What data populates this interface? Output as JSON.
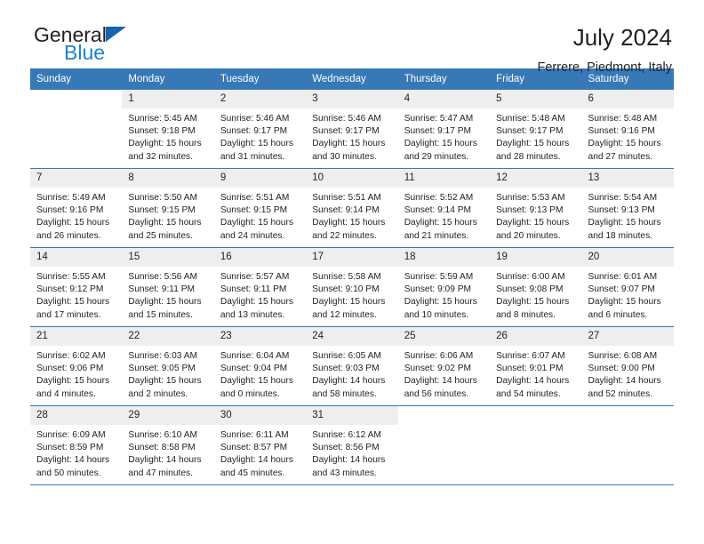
{
  "brand": {
    "name_part1": "General",
    "name_part2": "Blue",
    "logo_icon": "triangle-flag-icon"
  },
  "header": {
    "title": "July 2024",
    "location": "Ferrere, Piedmont, Italy"
  },
  "colors": {
    "header_blue": "#3778b7",
    "brand_blue": "#1b84c8",
    "logo_blue": "#1664ad",
    "daynum_bg": "#eeeeee",
    "text": "#231f20"
  },
  "calendar": {
    "weekday_headers": [
      "Sunday",
      "Monday",
      "Tuesday",
      "Wednesday",
      "Thursday",
      "Friday",
      "Saturday"
    ],
    "weeks": [
      [
        {
          "day": "",
          "lines": []
        },
        {
          "day": "1",
          "lines": [
            "Sunrise: 5:45 AM",
            "Sunset: 9:18 PM",
            "Daylight: 15 hours",
            "and 32 minutes."
          ]
        },
        {
          "day": "2",
          "lines": [
            "Sunrise: 5:46 AM",
            "Sunset: 9:17 PM",
            "Daylight: 15 hours",
            "and 31 minutes."
          ]
        },
        {
          "day": "3",
          "lines": [
            "Sunrise: 5:46 AM",
            "Sunset: 9:17 PM",
            "Daylight: 15 hours",
            "and 30 minutes."
          ]
        },
        {
          "day": "4",
          "lines": [
            "Sunrise: 5:47 AM",
            "Sunset: 9:17 PM",
            "Daylight: 15 hours",
            "and 29 minutes."
          ]
        },
        {
          "day": "5",
          "lines": [
            "Sunrise: 5:48 AM",
            "Sunset: 9:17 PM",
            "Daylight: 15 hours",
            "and 28 minutes."
          ]
        },
        {
          "day": "6",
          "lines": [
            "Sunrise: 5:48 AM",
            "Sunset: 9:16 PM",
            "Daylight: 15 hours",
            "and 27 minutes."
          ]
        }
      ],
      [
        {
          "day": "7",
          "lines": [
            "Sunrise: 5:49 AM",
            "Sunset: 9:16 PM",
            "Daylight: 15 hours",
            "and 26 minutes."
          ]
        },
        {
          "day": "8",
          "lines": [
            "Sunrise: 5:50 AM",
            "Sunset: 9:15 PM",
            "Daylight: 15 hours",
            "and 25 minutes."
          ]
        },
        {
          "day": "9",
          "lines": [
            "Sunrise: 5:51 AM",
            "Sunset: 9:15 PM",
            "Daylight: 15 hours",
            "and 24 minutes."
          ]
        },
        {
          "day": "10",
          "lines": [
            "Sunrise: 5:51 AM",
            "Sunset: 9:14 PM",
            "Daylight: 15 hours",
            "and 22 minutes."
          ]
        },
        {
          "day": "11",
          "lines": [
            "Sunrise: 5:52 AM",
            "Sunset: 9:14 PM",
            "Daylight: 15 hours",
            "and 21 minutes."
          ]
        },
        {
          "day": "12",
          "lines": [
            "Sunrise: 5:53 AM",
            "Sunset: 9:13 PM",
            "Daylight: 15 hours",
            "and 20 minutes."
          ]
        },
        {
          "day": "13",
          "lines": [
            "Sunrise: 5:54 AM",
            "Sunset: 9:13 PM",
            "Daylight: 15 hours",
            "and 18 minutes."
          ]
        }
      ],
      [
        {
          "day": "14",
          "lines": [
            "Sunrise: 5:55 AM",
            "Sunset: 9:12 PM",
            "Daylight: 15 hours",
            "and 17 minutes."
          ]
        },
        {
          "day": "15",
          "lines": [
            "Sunrise: 5:56 AM",
            "Sunset: 9:11 PM",
            "Daylight: 15 hours",
            "and 15 minutes."
          ]
        },
        {
          "day": "16",
          "lines": [
            "Sunrise: 5:57 AM",
            "Sunset: 9:11 PM",
            "Daylight: 15 hours",
            "and 13 minutes."
          ]
        },
        {
          "day": "17",
          "lines": [
            "Sunrise: 5:58 AM",
            "Sunset: 9:10 PM",
            "Daylight: 15 hours",
            "and 12 minutes."
          ]
        },
        {
          "day": "18",
          "lines": [
            "Sunrise: 5:59 AM",
            "Sunset: 9:09 PM",
            "Daylight: 15 hours",
            "and 10 minutes."
          ]
        },
        {
          "day": "19",
          "lines": [
            "Sunrise: 6:00 AM",
            "Sunset: 9:08 PM",
            "Daylight: 15 hours",
            "and 8 minutes."
          ]
        },
        {
          "day": "20",
          "lines": [
            "Sunrise: 6:01 AM",
            "Sunset: 9:07 PM",
            "Daylight: 15 hours",
            "and 6 minutes."
          ]
        }
      ],
      [
        {
          "day": "21",
          "lines": [
            "Sunrise: 6:02 AM",
            "Sunset: 9:06 PM",
            "Daylight: 15 hours",
            "and 4 minutes."
          ]
        },
        {
          "day": "22",
          "lines": [
            "Sunrise: 6:03 AM",
            "Sunset: 9:05 PM",
            "Daylight: 15 hours",
            "and 2 minutes."
          ]
        },
        {
          "day": "23",
          "lines": [
            "Sunrise: 6:04 AM",
            "Sunset: 9:04 PM",
            "Daylight: 15 hours",
            "and 0 minutes."
          ]
        },
        {
          "day": "24",
          "lines": [
            "Sunrise: 6:05 AM",
            "Sunset: 9:03 PM",
            "Daylight: 14 hours",
            "and 58 minutes."
          ]
        },
        {
          "day": "25",
          "lines": [
            "Sunrise: 6:06 AM",
            "Sunset: 9:02 PM",
            "Daylight: 14 hours",
            "and 56 minutes."
          ]
        },
        {
          "day": "26",
          "lines": [
            "Sunrise: 6:07 AM",
            "Sunset: 9:01 PM",
            "Daylight: 14 hours",
            "and 54 minutes."
          ]
        },
        {
          "day": "27",
          "lines": [
            "Sunrise: 6:08 AM",
            "Sunset: 9:00 PM",
            "Daylight: 14 hours",
            "and 52 minutes."
          ]
        }
      ],
      [
        {
          "day": "28",
          "lines": [
            "Sunrise: 6:09 AM",
            "Sunset: 8:59 PM",
            "Daylight: 14 hours",
            "and 50 minutes."
          ]
        },
        {
          "day": "29",
          "lines": [
            "Sunrise: 6:10 AM",
            "Sunset: 8:58 PM",
            "Daylight: 14 hours",
            "and 47 minutes."
          ]
        },
        {
          "day": "30",
          "lines": [
            "Sunrise: 6:11 AM",
            "Sunset: 8:57 PM",
            "Daylight: 14 hours",
            "and 45 minutes."
          ]
        },
        {
          "day": "31",
          "lines": [
            "Sunrise: 6:12 AM",
            "Sunset: 8:56 PM",
            "Daylight: 14 hours",
            "and 43 minutes."
          ]
        },
        {
          "day": "",
          "lines": []
        },
        {
          "day": "",
          "lines": []
        },
        {
          "day": "",
          "lines": []
        }
      ]
    ]
  }
}
